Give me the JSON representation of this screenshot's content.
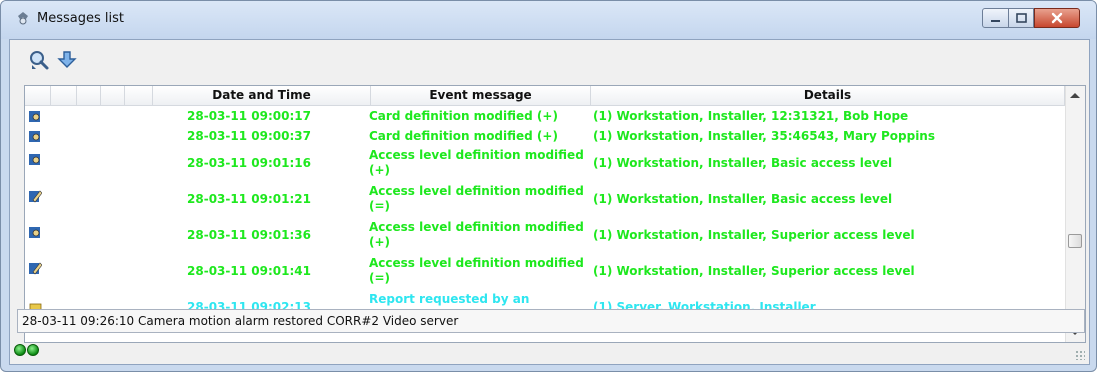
{
  "window": {
    "title": "Messages list",
    "icons": [
      "messages-app-icon",
      "minimize-icon",
      "maximize-icon",
      "close-icon"
    ]
  },
  "toolbar": {
    "buttons": [
      {
        "name": "search-messages",
        "icon": "magnifier-icon"
      },
      {
        "name": "scroll-down",
        "icon": "down-arrow-icon"
      }
    ]
  },
  "table": {
    "columns": [
      "Date and Time",
      "Event message",
      "Details"
    ],
    "rows": [
      {
        "icon": "card-user-icon",
        "date": "28-03-11 09:00:17",
        "event": "Card definition modified (+)",
        "details": "(1)  Workstation, Installer, 12:31321, Bob Hope",
        "color": "#1ee81e"
      },
      {
        "icon": "card-user-icon",
        "date": "28-03-11 09:00:37",
        "event": "Card definition modified (+)",
        "details": "(1)  Workstation, Installer, 35:46543, Mary Poppins",
        "color": "#1ee81e"
      },
      {
        "icon": "card-user-icon",
        "date": "28-03-11 09:01:16",
        "event": "Access level definition modified (+)",
        "details": "(1)  Workstation, Installer, Basic access level",
        "color": "#1ee81e"
      },
      {
        "icon": "edit-pencil-icon",
        "date": "28-03-11 09:01:21",
        "event": "Access level definition modified (=)",
        "details": "(1)  Workstation, Installer, Basic access level",
        "color": "#1ee81e"
      },
      {
        "icon": "card-user-icon",
        "date": "28-03-11 09:01:36",
        "event": "Access level definition modified (+)",
        "details": "(1)  Workstation, Installer, Superior access level",
        "color": "#1ee81e"
      },
      {
        "icon": "edit-pencil-icon",
        "date": "28-03-11 09:01:41",
        "event": "Access level definition modified (=)",
        "details": "(1)  Workstation, Installer, Superior access level",
        "color": "#1ee81e"
      },
      {
        "icon": "report-icon",
        "date": "28-03-11 09:02:13",
        "event": "Report requested by an",
        "details": "(1)  Server, Workstation, Installer",
        "color": "#2ee6f0"
      }
    ]
  },
  "status": {
    "message": "28-03-11 09:26:10  Camera motion alarm restored  CORR#2  Video server"
  },
  "indicators": [
    "connection-led-1",
    "connection-led-2"
  ]
}
